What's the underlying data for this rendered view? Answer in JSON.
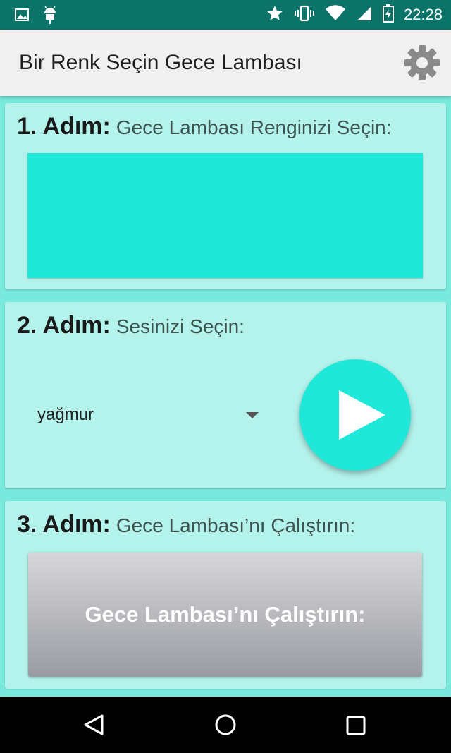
{
  "status_bar": {
    "time": "22:28",
    "left_icons": [
      "image-icon",
      "android-icon"
    ],
    "right_icons": [
      "star-icon",
      "vibrate-icon",
      "wifi-icon",
      "signal-icon",
      "battery-charging-icon"
    ]
  },
  "app_bar": {
    "title": "Bir Renk Seçin Gece Lambası",
    "settings_icon": "gear-icon"
  },
  "step1": {
    "number": "1. Adım:",
    "description": "Gece Lambası Renginizi Seçin:",
    "selected_color": "#1fe8d8"
  },
  "step2": {
    "number": "2. Adım:",
    "description": "Sesinizi Seçin:",
    "selected_sound": "yağmur",
    "play_icon": "play-icon"
  },
  "step3": {
    "number": "3. Adım:",
    "description": "Gece Lambası’nı Çalıştırın:",
    "button_label": "Gece Lambası’nı Çalıştırın:"
  },
  "nav_bar": {
    "icons": [
      "back-icon",
      "home-icon",
      "recents-icon"
    ]
  },
  "colors": {
    "background": "#79e9de",
    "card": "#b3f3ec",
    "accent": "#1fe8d8",
    "status_bar": "#0b7367"
  }
}
